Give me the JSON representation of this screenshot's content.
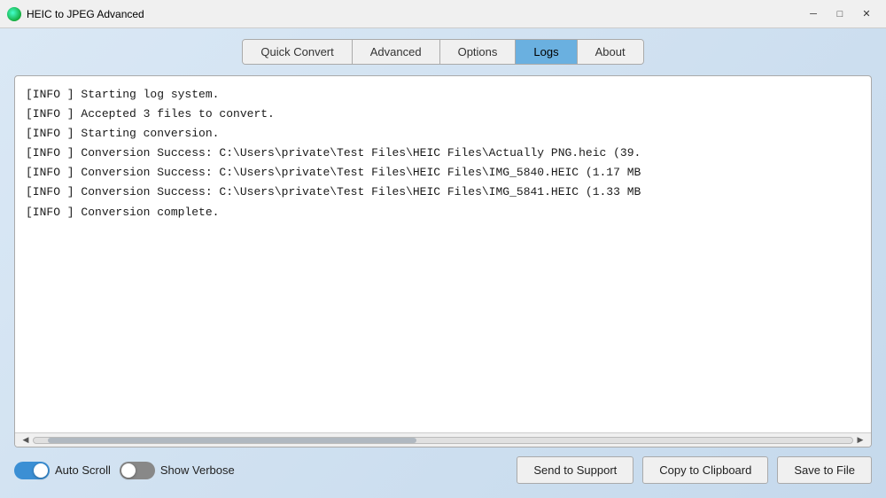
{
  "window": {
    "title": "HEIC to JPEG Advanced",
    "controls": {
      "minimize": "─",
      "maximize": "□",
      "close": "✕"
    }
  },
  "tabs": [
    {
      "id": "quick-convert",
      "label": "Quick Convert",
      "active": false
    },
    {
      "id": "advanced",
      "label": "Advanced",
      "active": false
    },
    {
      "id": "options",
      "label": "Options",
      "active": false
    },
    {
      "id": "logs",
      "label": "Logs",
      "active": true
    },
    {
      "id": "about",
      "label": "About",
      "active": false
    }
  ],
  "log": {
    "lines": [
      "[INFO     ] Starting log system.",
      "[INFO     ] Accepted 3 files to convert.",
      "[INFO     ] Starting conversion.",
      "[INFO     ] Conversion Success: C:\\Users\\private\\Test Files\\HEIC Files\\Actually PNG.heic (39.",
      "[INFO     ] Conversion Success: C:\\Users\\private\\Test Files\\HEIC Files\\IMG_5840.HEIC (1.17 MB",
      "[INFO     ] Conversion Success: C:\\Users\\private\\Test Files\\HEIC Files\\IMG_5841.HEIC (1.33 MB",
      "[INFO     ] Conversion complete."
    ]
  },
  "controls": {
    "auto_scroll": {
      "label": "Auto Scroll",
      "on": true
    },
    "show_verbose": {
      "label": "Show Verbose",
      "on": false
    }
  },
  "buttons": {
    "send_to_support": "Send to Support",
    "copy_to_clipboard": "Copy to Clipboard",
    "save_to_file": "Save to File"
  }
}
